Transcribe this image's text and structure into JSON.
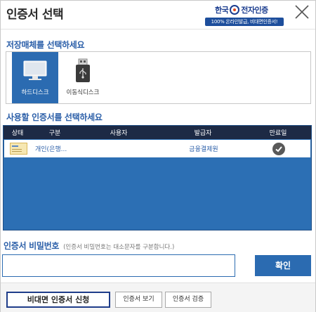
{
  "window": {
    "title": "인증서 선택"
  },
  "logo": {
    "brand": "한국전자인증",
    "brand_left": "한국",
    "brand_right": "전자인증",
    "tagline": "100% 온라인발급, 비대면인증서!"
  },
  "media": {
    "section_label": "저장매체를 선택하세요",
    "items": [
      {
        "label": "하드디스크",
        "icon": "monitor-icon",
        "selected": true
      },
      {
        "label": "이동식디스크",
        "icon": "usb-drive-icon",
        "selected": false
      }
    ]
  },
  "certificates": {
    "section_label": "사용할 인증서를 선택하세요",
    "columns": [
      "상태",
      "구분",
      "사용자",
      "발급자",
      "만료일"
    ],
    "rows": [
      {
        "status_icon": "certificate-icon",
        "type": "개인(은행...",
        "user": "",
        "issuer": "금융결제원",
        "expiry_icon": "check-circle-icon"
      }
    ]
  },
  "password": {
    "label": "인증서 비밀번호",
    "hint": "(인증서 비밀번호는 대소문자를 구분합니다.)",
    "value": "",
    "placeholder": ""
  },
  "buttons": {
    "confirm": "확인",
    "unface": "비대면 인증서 신청",
    "view": "인증서 보기",
    "verify": "인증서 검증"
  },
  "colors": {
    "accent": "#2b6bb1",
    "header_dark": "#1d2a45",
    "label_blue": "#2a5ea8"
  }
}
